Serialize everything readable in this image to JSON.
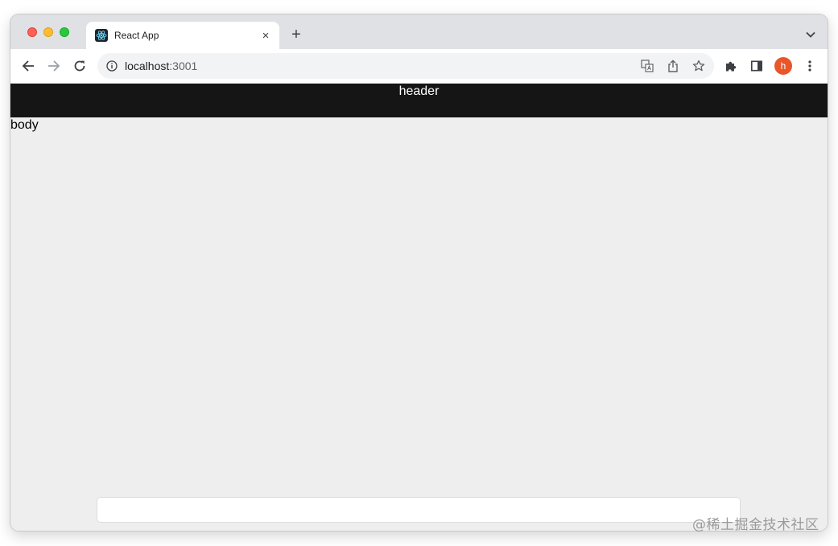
{
  "browser": {
    "tab_title": "React App",
    "tab_close": "×",
    "new_tab": "+",
    "url_host": "localhost",
    "url_port": ":3001",
    "profile_initial": "h"
  },
  "icons": {
    "favicon": "react-logo-icon",
    "back": "back-arrow-icon",
    "forward": "forward-arrow-icon",
    "reload": "reload-icon",
    "site_info": "info-icon",
    "translate": "translate-icon",
    "share": "share-icon",
    "bookmark": "star-icon",
    "extensions": "puzzle-icon",
    "side_panel": "side-panel-icon",
    "menu": "kebab-menu-icon",
    "tab_search": "chevron-down-icon"
  },
  "page": {
    "header_text": "header",
    "body_text": "body",
    "bottom_input_value": ""
  },
  "watermark": "@稀土掘金技术社区",
  "colors": {
    "header_bg": "#151515",
    "page_bg": "#eeeeee",
    "avatar_bg": "#e8562a"
  }
}
